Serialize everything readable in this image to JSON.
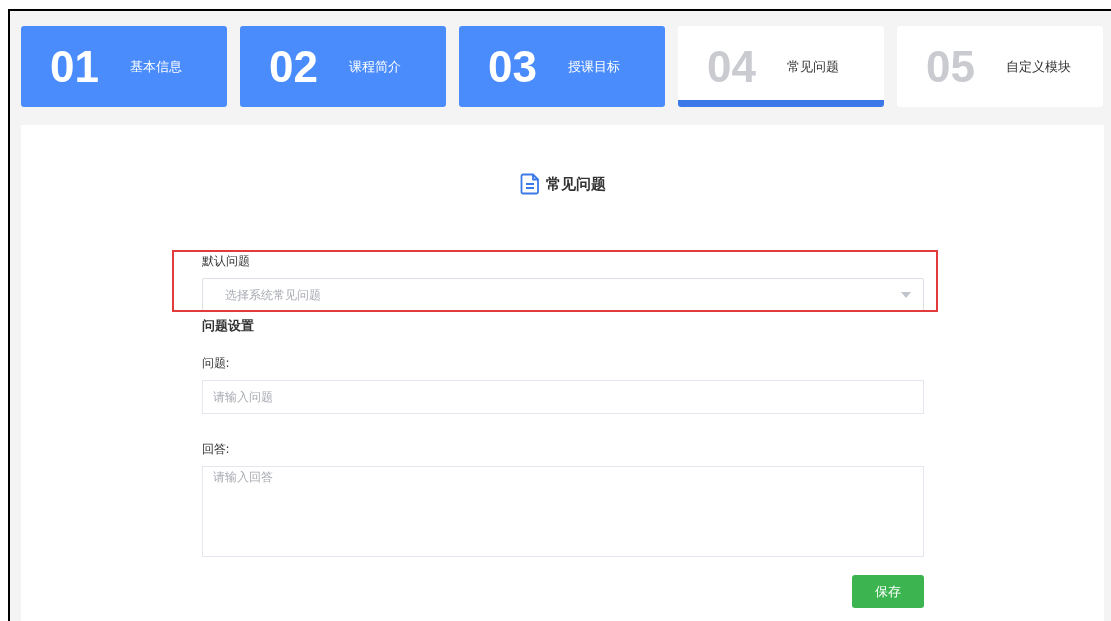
{
  "steps": [
    {
      "number": "01",
      "label": "基本信息",
      "completed": true,
      "selected": false
    },
    {
      "number": "02",
      "label": "课程简介",
      "completed": true,
      "selected": false
    },
    {
      "number": "03",
      "label": "授课目标",
      "completed": true,
      "selected": false
    },
    {
      "number": "04",
      "label": "常见问题",
      "completed": false,
      "selected": true
    },
    {
      "number": "05",
      "label": "自定义模块",
      "completed": false,
      "selected": false
    }
  ],
  "panel": {
    "title": "常见问题",
    "default_question": {
      "label": "默认问题",
      "placeholder": "选择系统常见问题",
      "highlighted": true
    },
    "section_title": "问题设置",
    "question": {
      "label": "问题:",
      "placeholder": "请输入问题"
    },
    "answer": {
      "label": "回答:",
      "placeholder": "请输入回答"
    },
    "save_button": "保存"
  }
}
